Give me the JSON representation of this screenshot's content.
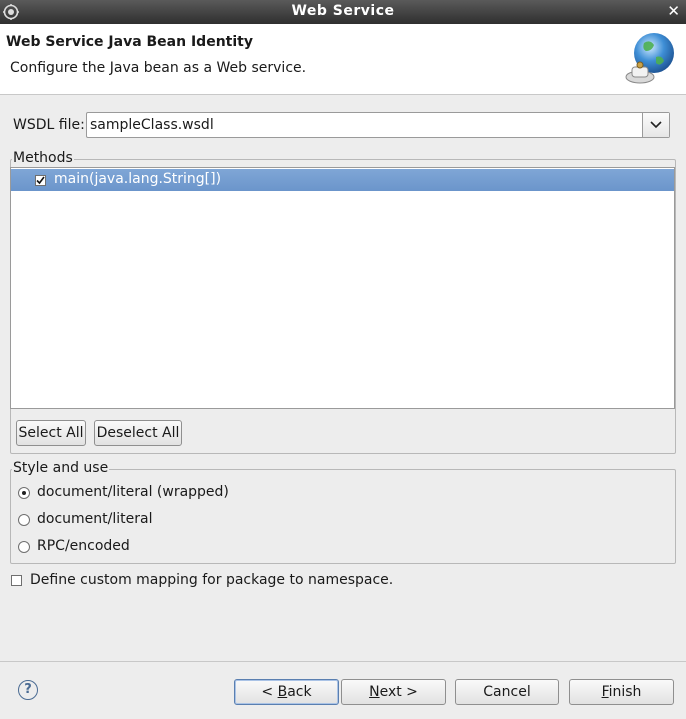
{
  "window": {
    "title": "Web Service"
  },
  "header": {
    "title": "Web Service Java Bean Identity",
    "description": "Configure the Java bean as a Web service."
  },
  "wsdl": {
    "label": "WSDL file:",
    "value": "sampleClass.wsdl"
  },
  "methods": {
    "group_label": "Methods",
    "items": [
      {
        "label": "main(java.lang.String[])",
        "checked": true
      }
    ],
    "select_all": "Select All",
    "deselect_all": "Deselect All"
  },
  "style": {
    "group_label": "Style and use",
    "options": [
      {
        "label": "document/literal (wrapped)",
        "selected": true
      },
      {
        "label": "document/literal",
        "selected": false
      },
      {
        "label": "RPC/encoded",
        "selected": false
      }
    ]
  },
  "custom_mapping": {
    "label": "Define custom mapping for package to namespace.",
    "checked": false
  },
  "footer": {
    "back_mnemonic": "B",
    "back_rest": "ack",
    "back_prefix": "< ",
    "next_mnemonic": "N",
    "next_rest": "ext >",
    "cancel": "Cancel",
    "finish_mnemonic": "F",
    "finish_rest": "inish"
  },
  "colors": {
    "selection": "#6b95cb",
    "titlebar": "#3a3a3a"
  }
}
